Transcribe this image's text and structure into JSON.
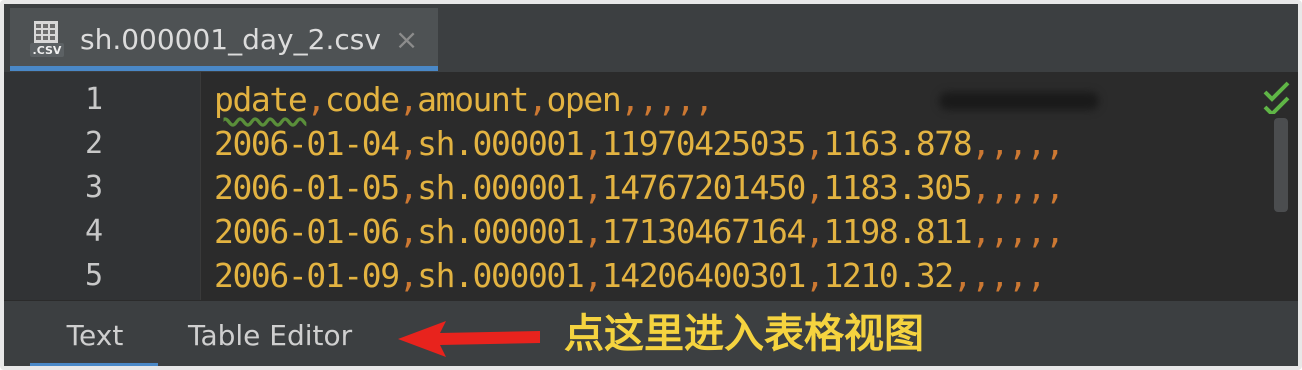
{
  "tab": {
    "icon": "csv-file-icon",
    "title": "sh.000001_day_2.csv",
    "close_glyph": "×"
  },
  "editor": {
    "line_numbers": [
      "1",
      "2",
      "3",
      "4",
      "5"
    ],
    "lines": [
      [
        "pdate",
        "code",
        "amount",
        "open",
        "",
        "",
        "",
        "",
        ""
      ],
      [
        "2006-01-04",
        "sh.000001",
        "11970425035",
        "1163.878",
        "",
        "",
        "",
        "",
        ""
      ],
      [
        "2006-01-05",
        "sh.000001",
        "14767201450",
        "1183.305",
        "",
        "",
        "",
        "",
        ""
      ],
      [
        "2006-01-06",
        "sh.000001",
        "17130467164",
        "1198.811",
        "",
        "",
        "",
        "",
        ""
      ],
      [
        "2006-01-09",
        "sh.000001",
        "14206400301",
        "1210.32",
        "",
        "",
        "",
        "",
        ""
      ]
    ],
    "status_icon": "inspection-ok-checkmark-icon"
  },
  "bottom_tabs": {
    "text_label": "Text",
    "table_editor_label": "Table Editor"
  },
  "annotation": {
    "text": "点这里进入表格视图",
    "arrow_icon": "red-left-arrow-icon"
  },
  "colors": {
    "value_text": "#e3b341",
    "separator": "#cc7832",
    "accent_underline": "#4a88c7",
    "annotation": "#f5d33f",
    "arrow": "#e8231d"
  }
}
